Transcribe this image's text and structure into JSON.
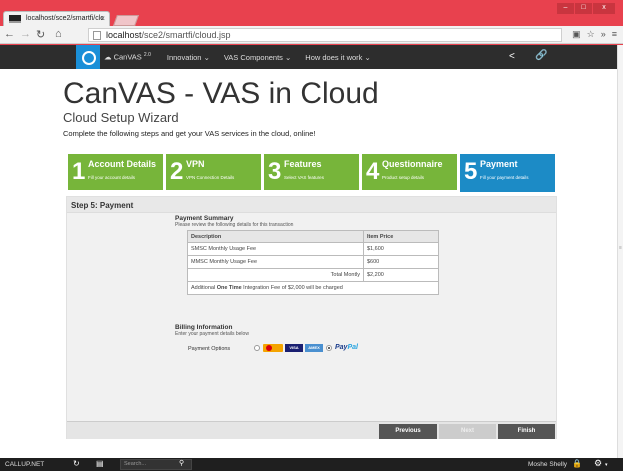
{
  "browser": {
    "tab_title": "localhost/sce2/smartfi/clc",
    "tab_close": "×",
    "url_host": "localhost",
    "url_path": "/sce2/smartfi/cloud.jsp",
    "window_controls": {
      "minimize": "–",
      "maximize": "□",
      "close": "x"
    }
  },
  "appnav": {
    "product_label": "CanVAS",
    "product_version": "2.0",
    "items": [
      "Innovation",
      "VAS Components",
      "How does it work"
    ]
  },
  "page": {
    "title": "CanVAS - VAS in Cloud",
    "subtitle": "Cloud Setup Wizard",
    "intro": "Complete the following steps and get your VAS services in the cloud, online!"
  },
  "steps": [
    {
      "num": "1",
      "title": "Account Details",
      "sub": "Fill your account details"
    },
    {
      "num": "2",
      "title": "VPN",
      "sub": "VPN Connection Details"
    },
    {
      "num": "3",
      "title": "Features",
      "sub": "Select VAS features"
    },
    {
      "num": "4",
      "title": "Questionnaire",
      "sub": "Product setup details"
    },
    {
      "num": "5",
      "title": "Payment",
      "sub": "Fill your payment details"
    }
  ],
  "panel": {
    "heading": "Step 5: Payment",
    "summary_title": "Payment Summary",
    "summary_sub": "Please review the following details for this transaction",
    "table": {
      "col_desc": "Description",
      "col_price": "Item Price",
      "rows": [
        {
          "desc": "SMSC Monthly Usage Fee",
          "price": "$1,600"
        },
        {
          "desc": "MMSC Monthly Usage Fee",
          "price": "$600"
        }
      ],
      "total_label": "Total Montly",
      "total_value": "$2,200",
      "fee_prefix": "Additional ",
      "fee_bold": "One Time",
      "fee_suffix": " Integration Fee of $2,000 will be charged"
    },
    "billing_title": "Billing Information",
    "billing_sub": "Enter your payment details below",
    "payment_label": "Payment Options",
    "visa": "VISA",
    "amex": "AMEX",
    "paypal_a": "Pay",
    "paypal_b": "Pal",
    "selected_option": "paypal"
  },
  "buttons": {
    "previous": "Previous",
    "next": "Next",
    "finish": "Finish"
  },
  "taskbar": {
    "brand": "CALLUP.NET",
    "search_placeholder": "Search...",
    "user": "Moshe Shelly"
  },
  "colors": {
    "accent": "#1c8bc6",
    "step_green": "#77b53a",
    "frame": "#e8414e",
    "header": "#2d2d2d"
  }
}
